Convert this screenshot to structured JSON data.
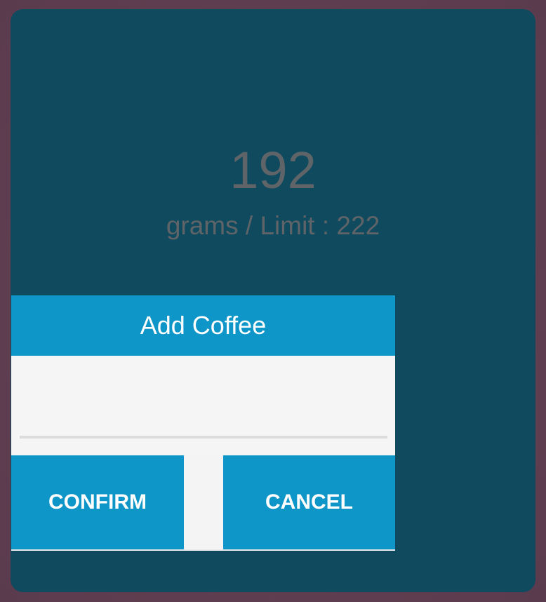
{
  "counter": {
    "value": "192",
    "subtitle": "grams / Limit : 222"
  },
  "dialog": {
    "title": "Add Coffee",
    "input_value": "",
    "confirm_label": "CONFIRM",
    "cancel_label": "CANCEL"
  },
  "colors": {
    "background": "#5e3f52",
    "card": "#0f4a5e",
    "accent": "#0f96c8",
    "muted_text": "#5f6468"
  }
}
